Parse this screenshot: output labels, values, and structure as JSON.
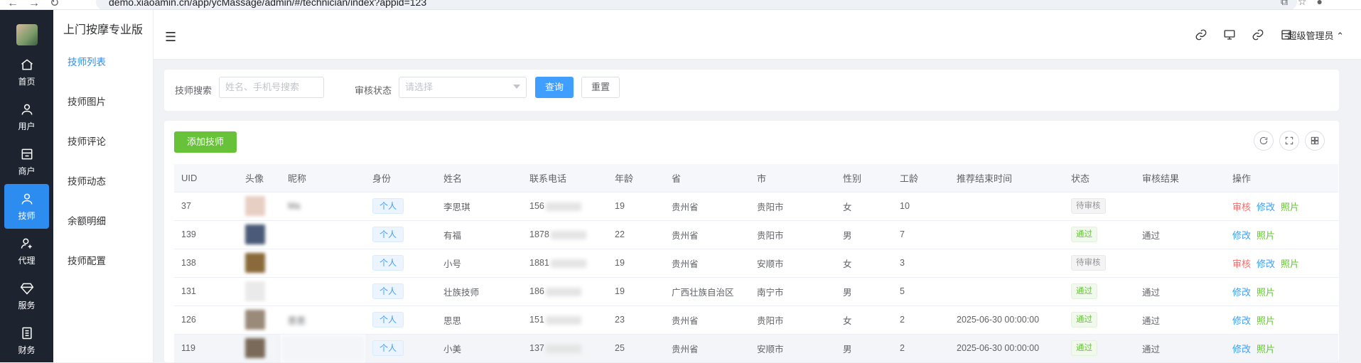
{
  "browser": {
    "url": "demo.xiaoamin.cn/app/ycMassage/admin/#/technician/index?appid=123"
  },
  "app_title": "上门按摩专业版",
  "sidenav": [
    {
      "label": "首页",
      "icon": "home-icon"
    },
    {
      "label": "用户",
      "icon": "user-icon"
    },
    {
      "label": "商户",
      "icon": "store-icon"
    },
    {
      "label": "技师",
      "icon": "technician-icon"
    },
    {
      "label": "代理",
      "icon": "agent-icon"
    },
    {
      "label": "服务",
      "icon": "diamond-icon"
    },
    {
      "label": "财务",
      "icon": "ledger-icon"
    }
  ],
  "submenu": [
    "技师列表",
    "技师图片",
    "技师评论",
    "技师动态",
    "余额明细",
    "技师配置"
  ],
  "header": {
    "user": "超级管理员"
  },
  "search": {
    "tech_label": "技师搜索",
    "tech_placeholder": "姓名、手机号搜索",
    "status_label": "审核状态",
    "status_placeholder": "请选择",
    "query_btn": "查询",
    "reset_btn": "重置"
  },
  "table": {
    "add_btn": "添加技师",
    "columns": [
      "UID",
      "头像",
      "昵称",
      "身份",
      "姓名",
      "联系电话",
      "年龄",
      "省",
      "市",
      "性别",
      "工龄",
      "推荐结束时间",
      "状态",
      "审核结果",
      "操作"
    ],
    "rows": [
      {
        "uid": "37",
        "nick": "Ma",
        "role": "个人",
        "name": "李思琪",
        "phone": "156",
        "age": "19",
        "prov": "贵州省",
        "city": "贵阳市",
        "sex": "女",
        "years": "10",
        "rec_end": "",
        "status": "待审核",
        "status_type": "gray",
        "result": "",
        "actions": [
          "审核",
          "修改",
          "照片"
        ]
      },
      {
        "uid": "139",
        "nick": "",
        "role": "个人",
        "name": "有福",
        "phone": "1878",
        "age": "22",
        "prov": "贵州省",
        "city": "贵阳市",
        "sex": "男",
        "years": "7",
        "rec_end": "",
        "status": "通过",
        "status_type": "green",
        "result": "通过",
        "actions": [
          "修改",
          "照片"
        ]
      },
      {
        "uid": "138",
        "nick": "",
        "role": "个人",
        "name": "小号",
        "phone": "1881",
        "age": "19",
        "prov": "贵州省",
        "city": "安顺市",
        "sex": "女",
        "years": "3",
        "rec_end": "",
        "status": "待审核",
        "status_type": "gray",
        "result": "",
        "actions": [
          "审核",
          "修改",
          "照片"
        ]
      },
      {
        "uid": "131",
        "nick": "",
        "role": "个人",
        "name": "壮族技师",
        "phone": "186",
        "age": "19",
        "prov": "广西壮族自治区",
        "city": "南宁市",
        "sex": "男",
        "years": "5",
        "rec_end": "",
        "status": "通过",
        "status_type": "green",
        "result": "通过",
        "actions": [
          "修改",
          "照片"
        ]
      },
      {
        "uid": "126",
        "nick": "思思",
        "role": "个人",
        "name": "思思",
        "phone": "151",
        "age": "23",
        "prov": "贵州省",
        "city": "贵阳市",
        "sex": "女",
        "years": "2",
        "rec_end": "2025-06-30 00:00:00",
        "status": "通过",
        "status_type": "green",
        "result": "通过",
        "actions": [
          "修改",
          "照片"
        ]
      },
      {
        "uid": "119",
        "nick": "",
        "role": "个人",
        "name": "小美",
        "phone": "137",
        "age": "25",
        "prov": "贵州省",
        "city": "安顺市",
        "sex": "男",
        "years": "2",
        "rec_end": "2025-06-30 00:00:00",
        "status": "通过",
        "status_type": "green",
        "result": "通过",
        "actions": [
          "修改",
          "照片"
        ]
      }
    ]
  }
}
